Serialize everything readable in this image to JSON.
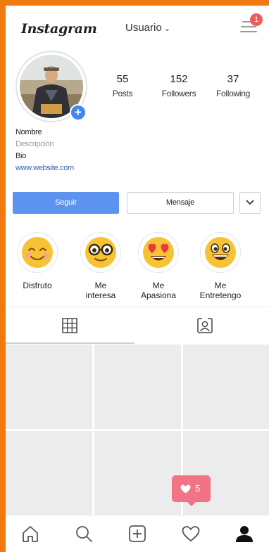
{
  "header": {
    "logo_text": "Instagram",
    "username": "Usuario",
    "username_chevron": "⌄",
    "notification_count": "1"
  },
  "profile": {
    "stats": [
      {
        "value": "55",
        "label": "Posts"
      },
      {
        "value": "152",
        "label": "Followers"
      },
      {
        "value": "37",
        "label": "Following"
      }
    ],
    "add_story_symbol": "+",
    "name": "Nombre",
    "description": "Descripción",
    "bio": "Bio",
    "website": "www.website.com"
  },
  "actions": {
    "follow_label": "Seguir",
    "message_label": "Mensaje",
    "more_icon": "chevron-down-icon"
  },
  "highlights": [
    {
      "icon": "blush-smile-emoji-icon",
      "label_line1": "Disfruto",
      "label_line2": ""
    },
    {
      "icon": "glasses-emoji-icon",
      "label_line1": "Me",
      "label_line2": "interesa"
    },
    {
      "icon": "heart-eyes-emoji-icon",
      "label_line1": "Me",
      "label_line2": "Apasiona"
    },
    {
      "icon": "grin-emoji-icon",
      "label_line1": "Me",
      "label_line2": "Entretengo"
    }
  ],
  "tabs": [
    {
      "icon": "grid-icon",
      "active": true
    },
    {
      "icon": "tagged-portrait-icon",
      "active": false
    }
  ],
  "likes_notification": {
    "icon": "heart-icon",
    "count": "5"
  },
  "bottom_nav": [
    {
      "icon": "home-icon"
    },
    {
      "icon": "search-icon"
    },
    {
      "icon": "add-post-icon"
    },
    {
      "icon": "activity-heart-icon"
    },
    {
      "icon": "profile-icon"
    }
  ],
  "colors": {
    "frame": "#f07a10",
    "follow_button": "#5b93ef",
    "add_story": "#3f87f5",
    "notification_badge": "#f05a5a",
    "likes_bubble": "#f27286",
    "emoji_yellow": "#f7c233",
    "heart_eyes": "#e83a3a"
  }
}
